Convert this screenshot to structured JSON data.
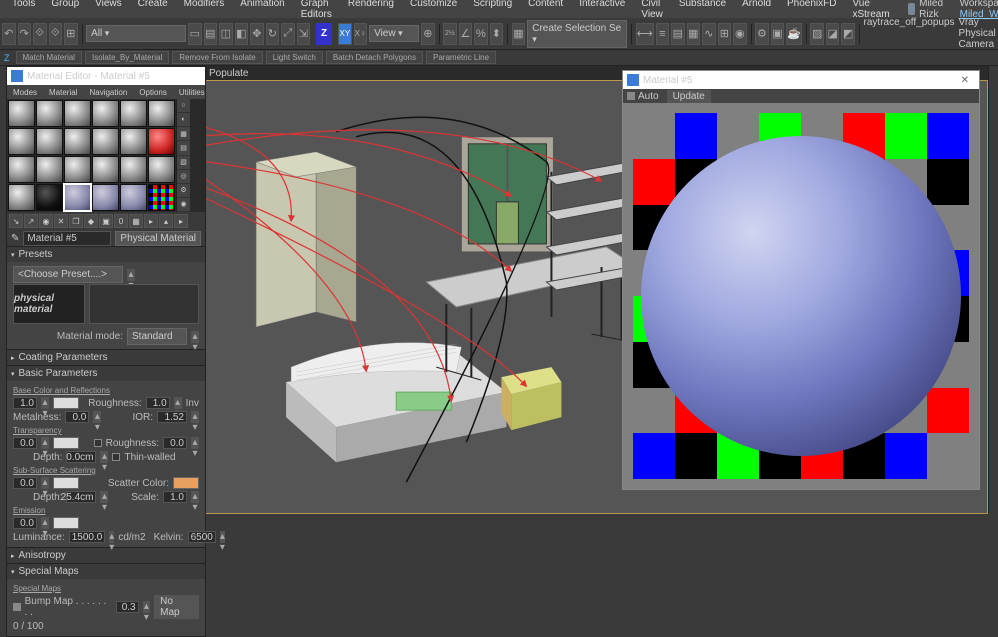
{
  "menu": [
    "Tools",
    "Group",
    "Views",
    "Create",
    "Modifiers",
    "Animation",
    "Graph Editors",
    "Rendering",
    "Customize",
    "Scripting",
    "Content",
    "Interactive",
    "Civil View",
    "Substance",
    "Arnold",
    "PhoenixFD",
    "Vue xStream"
  ],
  "user": {
    "name": "Miled Rizk"
  },
  "workspaces": {
    "label": "Workspaces:",
    "value": "Miled_WorkSpace"
  },
  "toolbar": {
    "selection_filter": "All",
    "create_dropdown": "Create Selection Se",
    "view_caption": "View",
    "cmds": [
      "Match Material",
      "Isolate_By_Material",
      "Remove From Isolate",
      "Light Switch",
      "Batch Detach Polygons",
      "Parametric Line"
    ],
    "extras": [
      "raytrace_off_popups",
      "Vray Physical Camera"
    ]
  },
  "populate": "Populate",
  "mat_editor": {
    "title": "Material Editor - Material #5",
    "menus": [
      "Modes",
      "Material",
      "Navigation",
      "Options",
      "Utilities"
    ],
    "name_field": "Material #5",
    "type_btn": "Physical Material",
    "presets": {
      "hdr": "Presets",
      "choose": "<Choose Preset....>",
      "thumb": "physical material",
      "mode_label": "Material mode:",
      "mode_value": "Standard"
    },
    "sections": {
      "coating": "Coating Parameters",
      "basic": "Basic Parameters",
      "aniso": "Anisotropy",
      "smaps": "Special Maps"
    },
    "basic": {
      "basecolor_lbl": "Base Color and Reflections",
      "roughness_lbl": "Roughness:",
      "inv": "Inv",
      "metalness_lbl": "Metalness:",
      "ior_lbl": "IOR:",
      "basecolor_val": "1.0",
      "roughness_val": "1.0",
      "metalness_val": "0.0",
      "ior_val": "1.52",
      "transp_lbl": "Transparency",
      "transp_val": "0.0",
      "transp_rough": "0.0",
      "rough_chk": "Roughness:",
      "depth_lbl": "Depth:",
      "depth_val": "0.0cm",
      "thin": "Thin-walled",
      "sss_lbl": "Sub-Surface Scattering",
      "sss_val": "0.0",
      "scatter_lbl": "Scatter Color:",
      "sss_depth": "25.4cm",
      "scale_lbl": "Scale:",
      "scale_val": "1.0",
      "emission_lbl": "Emission",
      "emission_val": "0.0",
      "lum_lbl": "Luminance:",
      "lum_val": "1500.0",
      "lum_unit": "cd/m2",
      "kelvin_lbl": "Kelvin:",
      "kelvin_val": "6500"
    },
    "smaps": {
      "sub": "Special Maps",
      "bump": "Bump Map . . . . . . . .",
      "bump_val": "0.3",
      "nomap": "No Map",
      "progress": "0 / 100"
    }
  },
  "preview": {
    "title": "Material #5",
    "auto": "Auto",
    "update": "Update"
  },
  "checker_colors": [
    "#808080",
    "#0000ff",
    "#808080",
    "#00ff00",
    "#808080",
    "#ff0000",
    "#00ff00",
    "#0000ff",
    "#ff0000",
    "#000000",
    "#808080",
    "#000000",
    "#808080",
    "#000000",
    "#808080",
    "#000000",
    "#000000",
    "#808080",
    "#ff0000",
    "#808080",
    "#0000ff",
    "#808080",
    "#00ff00",
    "#808080",
    "#808080",
    "#000000",
    "#808080",
    "#000000",
    "#808080",
    "#000000",
    "#808080",
    "#0000ff",
    "#00ff00",
    "#808080",
    "#0000ff",
    "#808080",
    "#00ff00",
    "#808080",
    "#ff0000",
    "#000000",
    "#000000",
    "#808080",
    "#000000",
    "#808080",
    "#000000",
    "#808080",
    "#000000",
    "#808080",
    "#808080",
    "#ff0000",
    "#808080",
    "#0000ff",
    "#808080",
    "#00ff00",
    "#808080",
    "#ff0000",
    "#0000ff",
    "#000000",
    "#00ff00",
    "#000000",
    "#ff0000",
    "#000000",
    "#0000ff",
    "#808080"
  ]
}
